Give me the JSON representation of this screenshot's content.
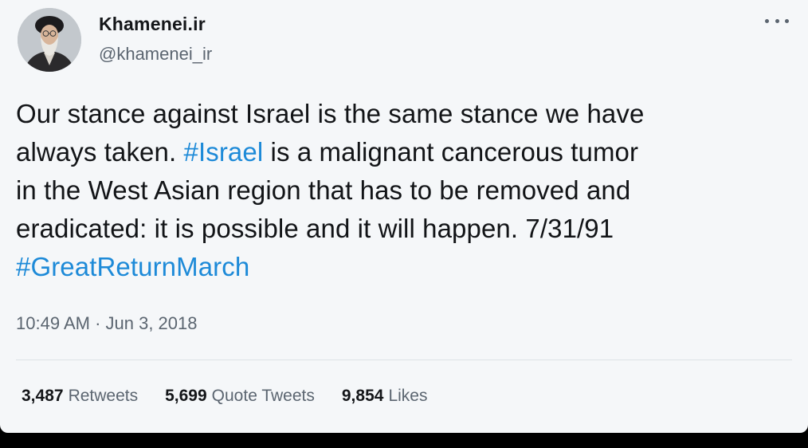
{
  "author": {
    "display_name": "Khamenei.ir",
    "handle": "@khamenei_ir",
    "avatar_icon": "profile-photo"
  },
  "more_icon": "more-dots-icon",
  "tweet": {
    "line1": "Our stance against Israel is the same stance we have",
    "line2_before": "always taken. ",
    "line2_hashtag": "#Israel",
    "line2_after": " is a malignant cancerous tumor",
    "line3": "in the West Asian region that has to be removed and",
    "line4": "eradicated: it is possible and it will happen. 7/31/91",
    "line5_hashtag": "#GreatReturnMarch"
  },
  "timestamp": "10:49 AM · Jun 3, 2018",
  "stats": {
    "retweets_count": "3,487",
    "retweets_label": "Retweets",
    "quotes_count": "5,699",
    "quotes_label": "Quote Tweets",
    "likes_count": "9,854",
    "likes_label": "Likes"
  },
  "colors": {
    "hashtag": "#1d8ad8",
    "background": "#f5f7f9",
    "text": "#121417",
    "secondary_text": "#5b6570"
  }
}
